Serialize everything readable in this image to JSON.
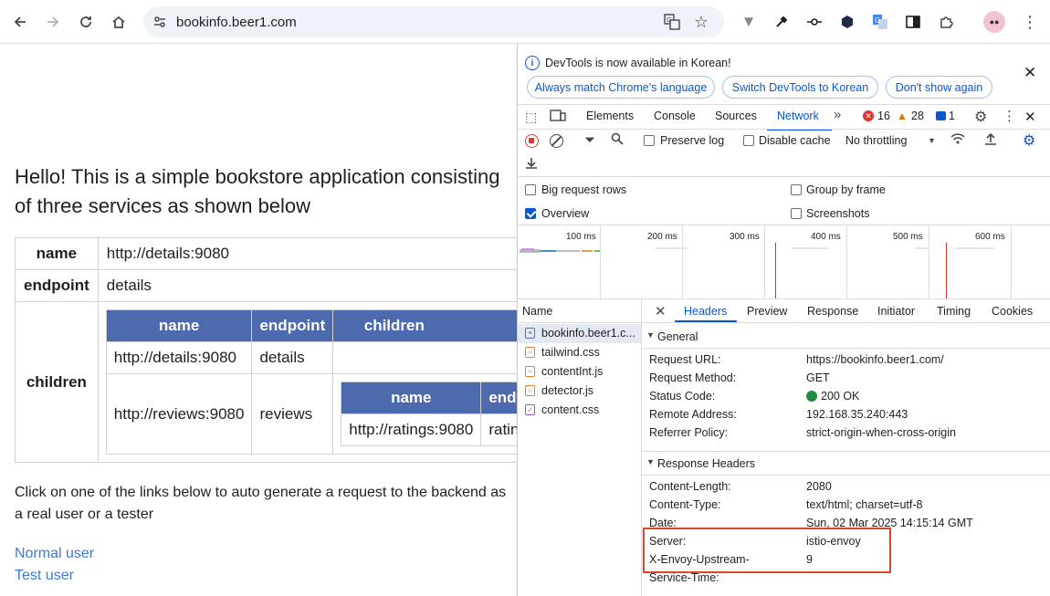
{
  "browser": {
    "url": "bookinfo.beer1.com",
    "extensions": [
      "vue-icon",
      "eyedropper-icon",
      "commit-icon",
      "hexagon-icon",
      "translate-ext-icon",
      "sidebar-icon",
      "puzzle-icon"
    ],
    "menu": "more-icon"
  },
  "page": {
    "heading": "Hello! This is a simple bookstore application consisting of three services as shown below",
    "table": {
      "name_key": "name",
      "name_val": "http://details:9080",
      "endpoint_key": "endpoint",
      "endpoint_val": "details",
      "children_key": "children",
      "inner_headers": [
        "name",
        "endpoint",
        "children"
      ],
      "row1": [
        "http://details:9080",
        "details"
      ],
      "row2": [
        "http://reviews:9080",
        "reviews"
      ],
      "nested_headers": [
        "name",
        "endp"
      ],
      "nested_row": [
        "http://ratings:9080",
        "rating"
      ]
    },
    "description": "Click on one of the links below to auto generate a request to the backend as a real user or a tester",
    "link_normal": "Normal user",
    "link_test": "Test user"
  },
  "devtools": {
    "banner": "DevTools is now available in Korean!",
    "btn_match": "Always match Chrome's language",
    "btn_switch": "Switch DevTools to Korean",
    "btn_dont": "Don't show again",
    "tabs": [
      "Elements",
      "Console",
      "Sources",
      "Network"
    ],
    "errors": "16",
    "warnings": "28",
    "info": "1",
    "preserve_log": "Preserve log",
    "disable_cache": "Disable cache",
    "throttling": "No throttling",
    "big_rows": "Big request rows",
    "group_frame": "Group by frame",
    "overview": "Overview",
    "screenshots": "Screenshots",
    "ticks": [
      "100 ms",
      "200 ms",
      "300 ms",
      "400 ms",
      "500 ms",
      "600 ms"
    ],
    "name_col": "Name",
    "files": [
      "bookinfo.beer1.c...",
      "tailwind.css",
      "contentInt.js",
      "detector.js",
      "content.css"
    ],
    "detail_tabs": [
      "Headers",
      "Preview",
      "Response",
      "Initiator",
      "Timing",
      "Cookies"
    ],
    "general_title": "General",
    "general": [
      {
        "k": "Request URL:",
        "v": "https://bookinfo.beer1.com/"
      },
      {
        "k": "Request Method:",
        "v": "GET"
      },
      {
        "k": "Status Code:",
        "v": "200 OK"
      },
      {
        "k": "Remote Address:",
        "v": "192.168.35.240:443"
      },
      {
        "k": "Referrer Policy:",
        "v": "strict-origin-when-cross-origin"
      }
    ],
    "response_title": "Response Headers",
    "response": [
      {
        "k": "Content-Length:",
        "v": "2080"
      },
      {
        "k": "Content-Type:",
        "v": "text/html; charset=utf-8"
      },
      {
        "k": "Date:",
        "v": "Sun, 02 Mar 2025 14:15:14 GMT"
      },
      {
        "k": "Server:",
        "v": "istio-envoy"
      },
      {
        "k": "X-Envoy-Upstream-",
        "v": "9"
      },
      {
        "k": "Service-Time:",
        "v": ""
      }
    ],
    "colors": {
      "accent": "#0b57d0",
      "error": "#dc362e",
      "warning": "#e37400",
      "highlight": "#d9472b",
      "status_ok": "#1e8e3e"
    }
  }
}
